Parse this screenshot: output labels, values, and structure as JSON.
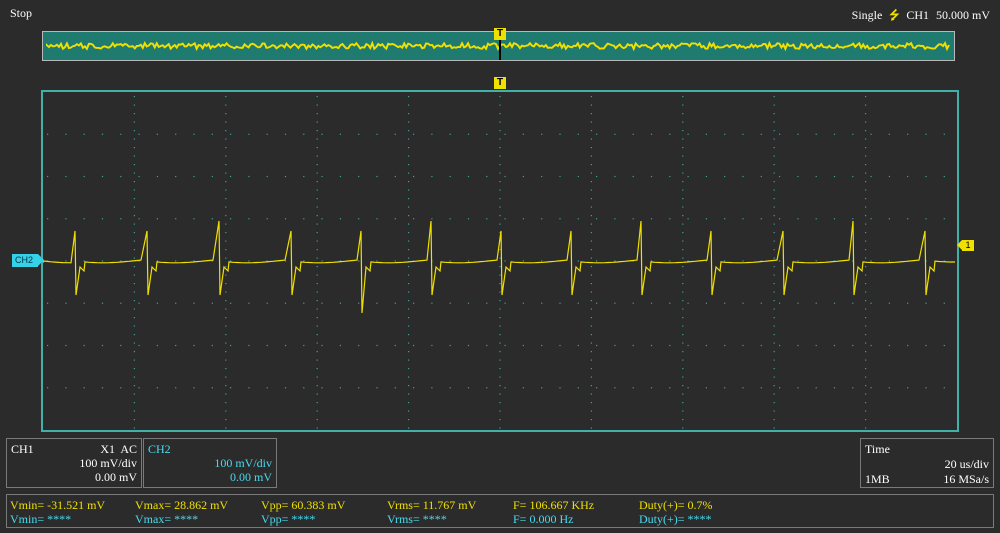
{
  "status": {
    "run_state": "Stop",
    "trigger_mode": "Single",
    "trigger_channel": "CH1",
    "trigger_level": "50.000 mV"
  },
  "markers": {
    "trigger_label": "T",
    "ch2_label": "CH2",
    "level_label": "1"
  },
  "ch1_panel": {
    "name": "CH1",
    "probe": "X1",
    "coupling": "AC",
    "scale": "100 mV/div",
    "offset": "0.00 mV"
  },
  "ch2_panel": {
    "name": "CH2",
    "scale": "100 mV/div",
    "offset": "0.00 mV"
  },
  "time_panel": {
    "title": "Time",
    "timebase": "20 us/div",
    "memory": "1MB",
    "sample_rate": "16 MSa/s"
  },
  "measurements": {
    "ch1": {
      "vmin": "Vmin= -31.521 mV",
      "vmax": "Vmax= 28.862 mV",
      "vpp": "Vpp= 60.383 mV",
      "vrms": "Vrms= 11.767 mV",
      "freq": "F= 106.667 KHz",
      "duty": "Duty(+)= 0.7%"
    },
    "ch2": {
      "vmin": "Vmin= ****",
      "vmax": "Vmax= ****",
      "vpp": "Vpp= ****",
      "vrms": "Vrms= ****",
      "freq": "F= 0.000 Hz",
      "duty": "Duty(+)= ****"
    }
  },
  "colors": {
    "ch1_trace": "#f0e000",
    "ch2_color": "#48dcf0",
    "screen_border": "#40b0a8",
    "overview_fill": "#1f7a70",
    "grid": "#3aa39a",
    "background": "#2b2b2b"
  }
}
